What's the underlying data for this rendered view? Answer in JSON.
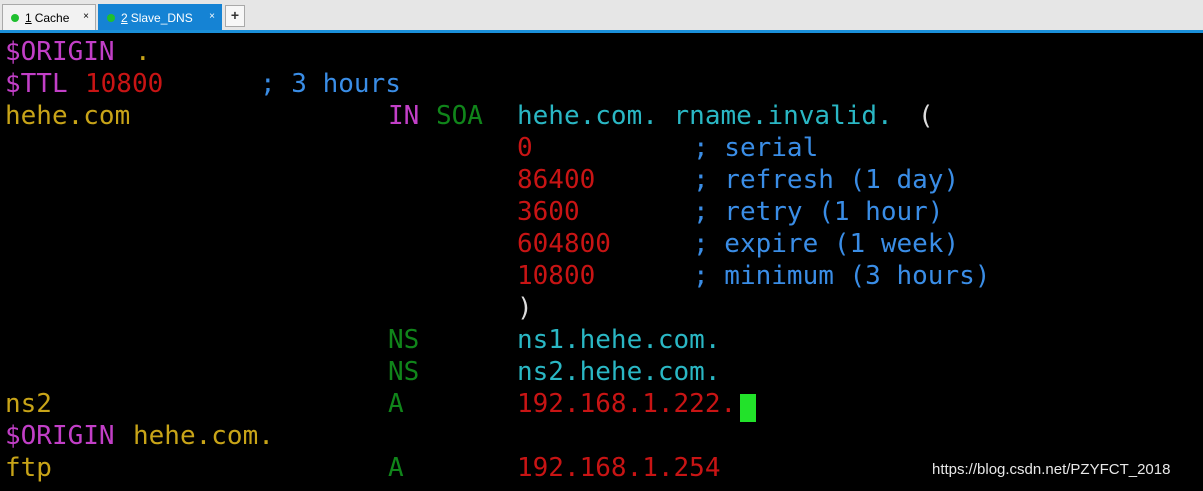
{
  "tabs": [
    {
      "num": "1",
      "label": "Cache",
      "close": "×"
    },
    {
      "num": "2",
      "label": "Slave_DNS",
      "close": "×"
    }
  ],
  "add_tab": "+",
  "terminal": {
    "l1": {
      "a": "$ORIGIN",
      "b": "."
    },
    "l2": {
      "a": "$TTL",
      "b": "10800",
      "c": "; 3 hours"
    },
    "l3": {
      "a": "hehe.com",
      "b": "IN",
      "c": "SOA",
      "d": "hehe.com. rname.invalid.",
      "e": "("
    },
    "l4": {
      "a": "0",
      "b": "; serial"
    },
    "l5": {
      "a": "86400",
      "b": "; refresh (1 day)"
    },
    "l6": {
      "a": "3600",
      "b": "; retry (1 hour)"
    },
    "l7": {
      "a": "604800",
      "b": "; expire (1 week)"
    },
    "l8": {
      "a": "10800",
      "b": "; minimum (3 hours)"
    },
    "l9": {
      "a": ")"
    },
    "l10": {
      "a": "NS",
      "b": "ns1.hehe.com."
    },
    "l11": {
      "a": "NS",
      "b": "ns2.hehe.com."
    },
    "l12": {
      "a": "ns2",
      "b": "A",
      "c": "192.168.1.222."
    },
    "l13": {
      "a": "$ORIGIN",
      "b": "hehe.com."
    },
    "l14": {
      "a": "ftp",
      "b": "A",
      "c": "192.168.1.254"
    }
  },
  "watermark": "https://blog.csdn.net/PZYFCT_2018"
}
